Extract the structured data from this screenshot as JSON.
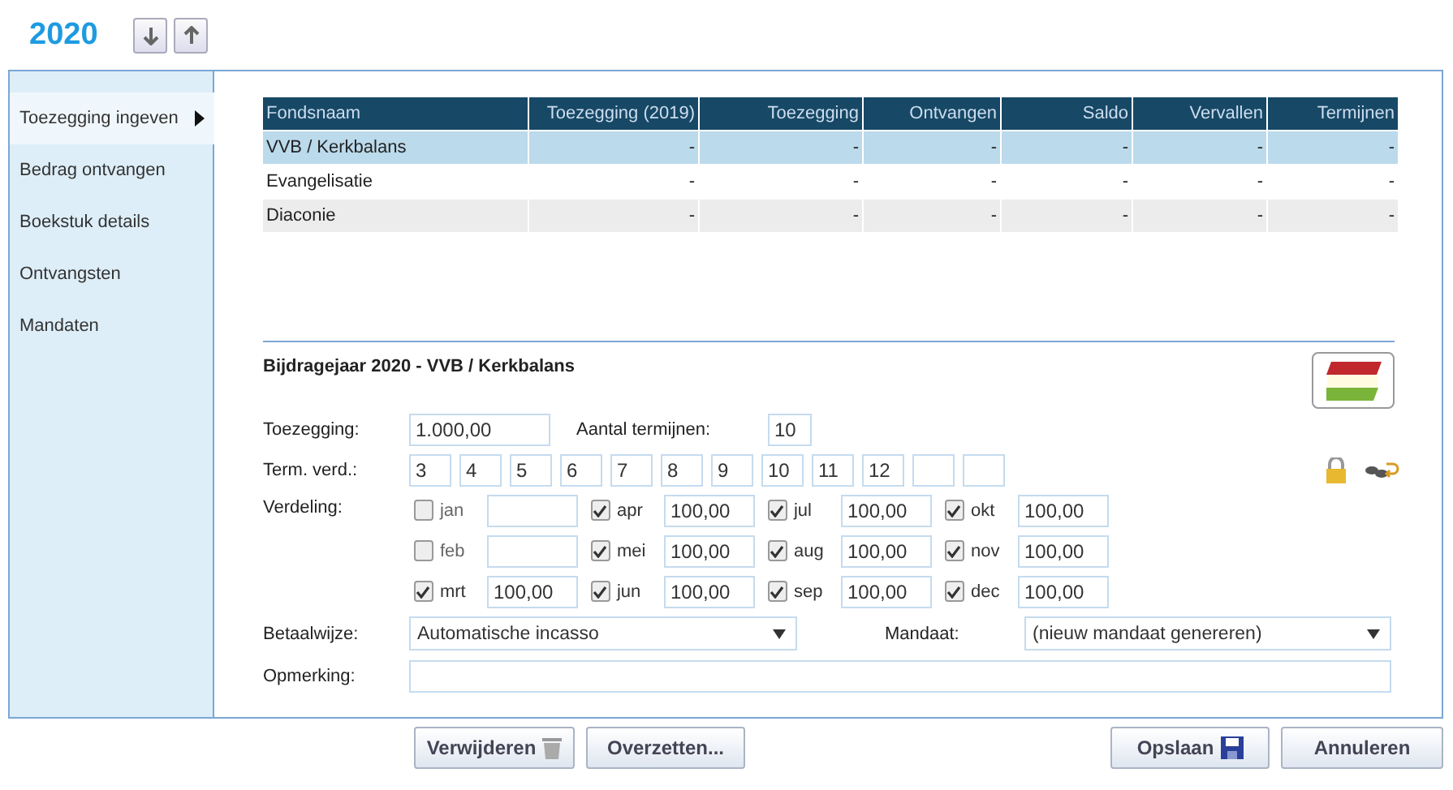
{
  "year": "2020",
  "sidebar": {
    "items": [
      {
        "label": "Toezegging ingeven",
        "selected": true
      },
      {
        "label": "Bedrag ontvangen",
        "selected": false
      },
      {
        "label": "Boekstuk details",
        "selected": false
      },
      {
        "label": "Ontvangsten",
        "selected": false
      },
      {
        "label": "Mandaten",
        "selected": false
      }
    ]
  },
  "table": {
    "columns": [
      "Fondsnaam",
      "Toezegging (2019)",
      "Toezegging",
      "Ontvangen",
      "Saldo",
      "Vervallen",
      "Termijnen"
    ],
    "rows": [
      {
        "cells": [
          "VVB / Kerkbalans",
          "-",
          "-",
          "-",
          "-",
          "-",
          "-"
        ],
        "selected": true
      },
      {
        "cells": [
          "Evangelisatie",
          "-",
          "-",
          "-",
          "-",
          "-",
          "-"
        ],
        "selected": false
      },
      {
        "cells": [
          "Diaconie",
          "-",
          "-",
          "-",
          "-",
          "-",
          "-"
        ],
        "selected": false
      }
    ]
  },
  "form": {
    "title": "Bijdragejaar 2020 - VVB / Kerkbalans",
    "toezegging_label": "Toezegging:",
    "toezegging": "1.000,00",
    "termijnen_label": "Aantal termijnen:",
    "termijnen": "10",
    "term_label": "Term. verd.:",
    "terms": [
      {
        "kind": "filled",
        "value": "3"
      },
      {
        "kind": "filled",
        "value": "4"
      },
      {
        "kind": "filled",
        "value": "5"
      },
      {
        "kind": "filled",
        "value": "6"
      },
      {
        "kind": "filled",
        "value": "7"
      },
      {
        "kind": "filled",
        "value": "8"
      },
      {
        "kind": "filled",
        "value": "9"
      },
      {
        "kind": "filled",
        "value": "10"
      },
      {
        "kind": "filled",
        "value": "11"
      },
      {
        "kind": "filled",
        "value": "12"
      },
      {
        "kind": "blank"
      },
      {
        "kind": "blank"
      }
    ],
    "verdeling_label": "Verdeling:",
    "months": [
      {
        "label": "jan",
        "checked": false
      },
      {
        "label": "feb",
        "checked": false
      },
      {
        "label": "mrt",
        "checked": true,
        "value": "100,00"
      },
      {
        "label": "apr",
        "checked": true,
        "value": "100,00"
      },
      {
        "label": "mei",
        "checked": true,
        "value": "100,00"
      },
      {
        "label": "jun",
        "checked": true,
        "value": "100,00"
      },
      {
        "label": "jul",
        "checked": true,
        "value": "100,00"
      },
      {
        "label": "aug",
        "checked": true,
        "value": "100,00"
      },
      {
        "label": "sep",
        "checked": true,
        "value": "100,00"
      },
      {
        "label": "okt",
        "checked": true,
        "value": "100,00"
      },
      {
        "label": "nov",
        "checked": true,
        "value": "100,00"
      },
      {
        "label": "dec",
        "checked": true,
        "value": "100,00"
      }
    ],
    "betaalwijze_label": "Betaalwijze:",
    "betaalwijze": "Automatische incasso",
    "mandaat_label": "Mandaat:",
    "mandaat": "(nieuw mandaat genereren)",
    "opmerking_label": "Opmerking:"
  },
  "buttons": {
    "left": [
      "Verwijderen",
      "Overzetten..."
    ],
    "right": [
      "Opslaan",
      "Annuleren"
    ]
  }
}
